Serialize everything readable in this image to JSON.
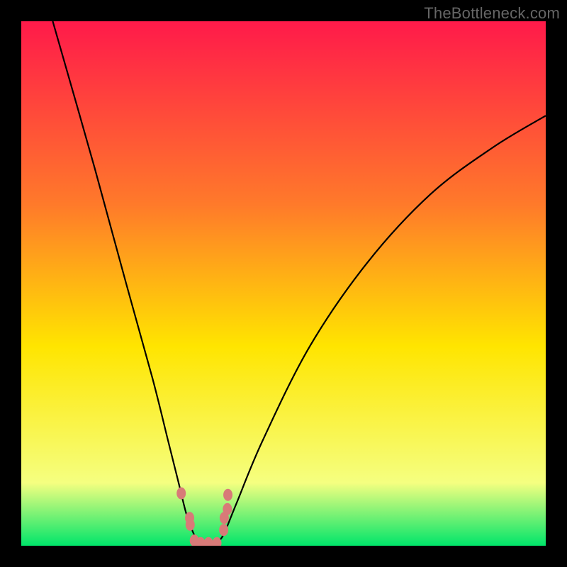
{
  "watermark": "TheBottleneck.com",
  "colors": {
    "frame": "#000000",
    "gradient_top": "#ff1a4a",
    "gradient_mid1": "#ff7a2a",
    "gradient_mid2": "#ffe500",
    "gradient_mid3": "#f5ff80",
    "gradient_bottom": "#00e56a",
    "curve": "#000000",
    "marker": "#d87a78"
  },
  "chart_data": {
    "type": "line",
    "title": "",
    "xlabel": "",
    "ylabel": "",
    "xlim": [
      0,
      100
    ],
    "ylim": [
      0,
      100
    ],
    "curves": [
      {
        "name": "left-curve",
        "points": [
          {
            "x": 6,
            "y": 100
          },
          {
            "x": 14,
            "y": 72
          },
          {
            "x": 20,
            "y": 50
          },
          {
            "x": 25,
            "y": 32
          },
          {
            "x": 28,
            "y": 20
          },
          {
            "x": 30,
            "y": 12
          },
          {
            "x": 31.5,
            "y": 6
          },
          {
            "x": 33,
            "y": 2
          },
          {
            "x": 34,
            "y": 0.5
          }
        ]
      },
      {
        "name": "right-curve",
        "points": [
          {
            "x": 37,
            "y": 0.5
          },
          {
            "x": 38.5,
            "y": 2
          },
          {
            "x": 41,
            "y": 8
          },
          {
            "x": 46,
            "y": 20
          },
          {
            "x": 55,
            "y": 38
          },
          {
            "x": 66,
            "y": 54
          },
          {
            "x": 78,
            "y": 67
          },
          {
            "x": 90,
            "y": 76
          },
          {
            "x": 100,
            "y": 82
          }
        ]
      }
    ],
    "markers": [
      {
        "x": 30.5,
        "y": 10
      },
      {
        "x": 32.1,
        "y": 5.3
      },
      {
        "x": 32.2,
        "y": 4
      },
      {
        "x": 33,
        "y": 1
      },
      {
        "x": 34.2,
        "y": 0.5
      },
      {
        "x": 35.7,
        "y": 0.5
      },
      {
        "x": 37.3,
        "y": 0.5
      },
      {
        "x": 38.6,
        "y": 3
      },
      {
        "x": 38.7,
        "y": 5.3
      },
      {
        "x": 39.3,
        "y": 7
      },
      {
        "x": 39.4,
        "y": 9.7
      }
    ]
  }
}
